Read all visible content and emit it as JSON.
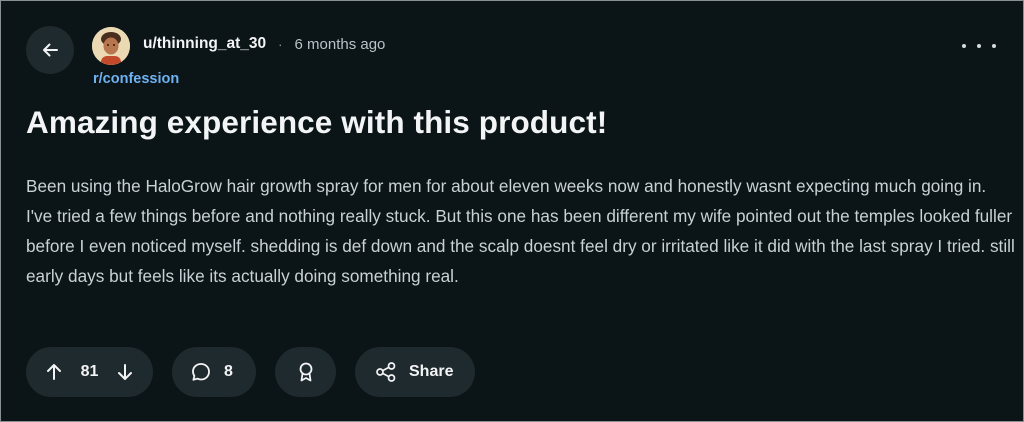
{
  "post": {
    "author": "u/thinning_at_30",
    "separator": "·",
    "age": "6 months ago",
    "subreddit": "r/confession",
    "title": "Amazing experience with this product!",
    "body": "Been using the HaloGrow hair growth spray for men for about eleven weeks now and honestly wasnt expecting much going in. I've tried a few things before and nothing really stuck. But this one has been different my wife pointed out the temples looked fuller before I even noticed myself. shedding is def down and the scalp doesnt feel dry or irritated like it did with the last spray I tried. still early days but feels like its actually doing something real."
  },
  "actions": {
    "vote_count": "81",
    "comment_count": "8",
    "share_label": "Share"
  },
  "icons": {
    "back": "arrow-left-icon",
    "more": "more-horizontal-icon",
    "upvote": "arrow-up-icon",
    "downvote": "arrow-down-icon",
    "comment": "speech-bubble-icon",
    "award": "award-ribbon-icon",
    "share": "share-nodes-icon"
  },
  "colors": {
    "background": "#0b1416",
    "pill": "#1f2a2e",
    "subreddit_link": "#6fb2f2",
    "body_text": "#c8d1d5"
  }
}
